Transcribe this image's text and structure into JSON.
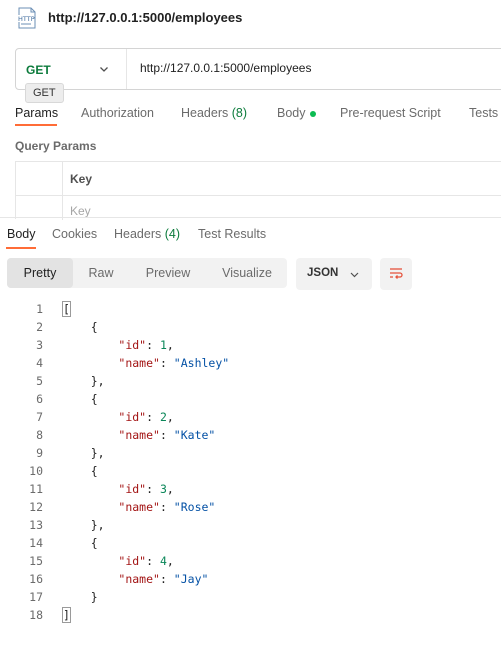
{
  "title_bar": {
    "icon": "http-icon",
    "title": "http://127.0.0.1:5000/employees"
  },
  "request": {
    "method": "GET",
    "url": "http://127.0.0.1:5000/employees",
    "tooltip": "GET",
    "tabs": [
      {
        "label": "Params",
        "active": true
      },
      {
        "label": "Authorization"
      },
      {
        "label": "Headers",
        "count": "(8)"
      },
      {
        "label": "Body",
        "dot": true
      },
      {
        "label": "Pre-request Script"
      },
      {
        "label": "Tests"
      }
    ],
    "query_params": {
      "label": "Query Params",
      "key_header": "Key",
      "key_placeholder": "Key"
    }
  },
  "response": {
    "tabs": [
      {
        "label": "Body",
        "active": true
      },
      {
        "label": "Cookies"
      },
      {
        "label": "Headers",
        "count": "(4)"
      },
      {
        "label": "Test Results"
      }
    ],
    "views": [
      "Pretty",
      "Raw",
      "Preview",
      "Visualize"
    ],
    "active_view": "Pretty",
    "format": "JSON",
    "lines": [
      "[",
      "    {",
      "        \"id\": 1,",
      "        \"name\": \"Ashley\"",
      "    },",
      "    {",
      "        \"id\": 2,",
      "        \"name\": \"Kate\"",
      "    },",
      "    {",
      "        \"id\": 3,",
      "        \"name\": \"Rose\"",
      "    },",
      "    {",
      "        \"id\": 4,",
      "        \"name\": \"Jay\"",
      "    }",
      "]"
    ]
  },
  "colors": {
    "accent": "#ff6c37",
    "method": "#0c7b3c",
    "json_key": "#a31515",
    "json_string": "#0451a5",
    "json_number": "#098658"
  }
}
